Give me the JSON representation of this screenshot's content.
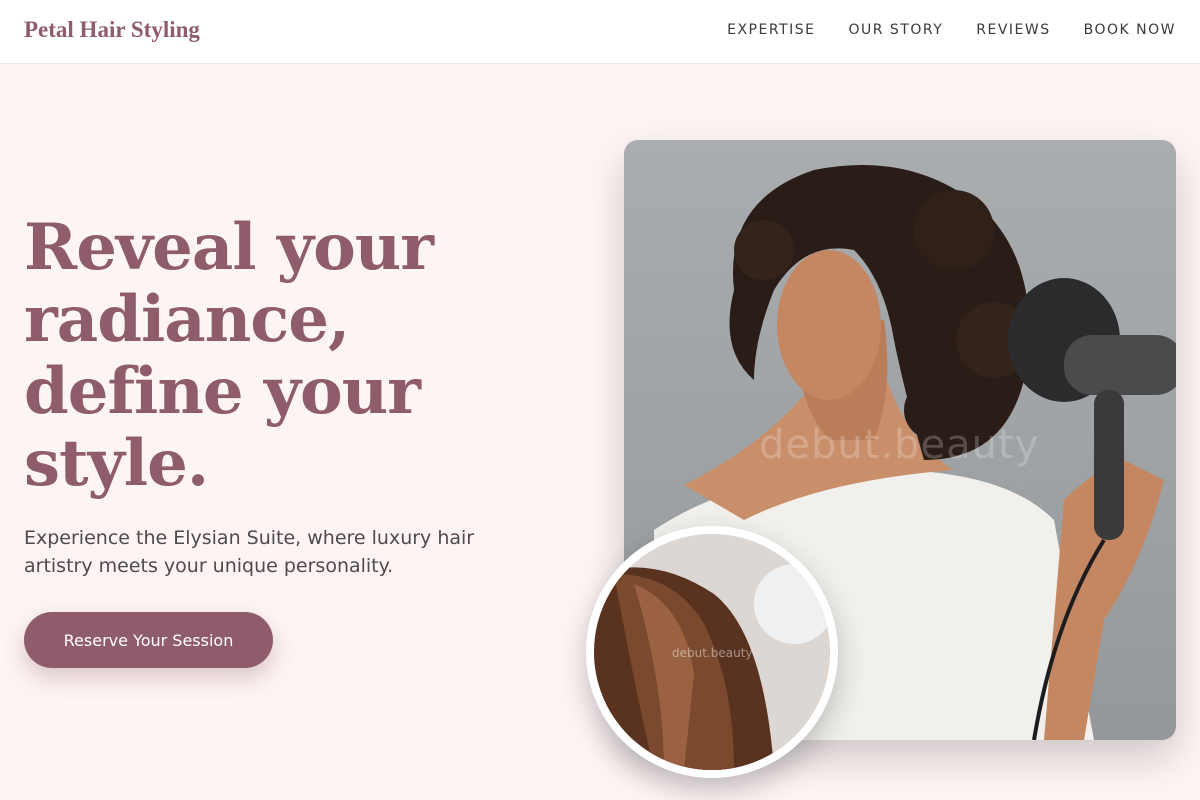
{
  "brand": {
    "name": "Petal Hair Styling"
  },
  "nav": {
    "items": [
      {
        "label": "EXPERTISE"
      },
      {
        "label": "OUR STORY"
      },
      {
        "label": "REVIEWS"
      },
      {
        "label": "BOOK NOW"
      }
    ]
  },
  "hero": {
    "headline": "Reveal your radiance, define your style.",
    "subtitle": "Experience the Elysian Suite, where luxury hair artistry meets your unique personality.",
    "cta_label": "Reserve Your Session"
  },
  "images": {
    "main_watermark": "debut.beauty",
    "inset_watermark": "debut.beauty"
  },
  "colors": {
    "accent": "#8f5c6b",
    "background": "#fdf4f4",
    "nav_background": "#ffffff",
    "body_text": "#4f4a4d"
  }
}
